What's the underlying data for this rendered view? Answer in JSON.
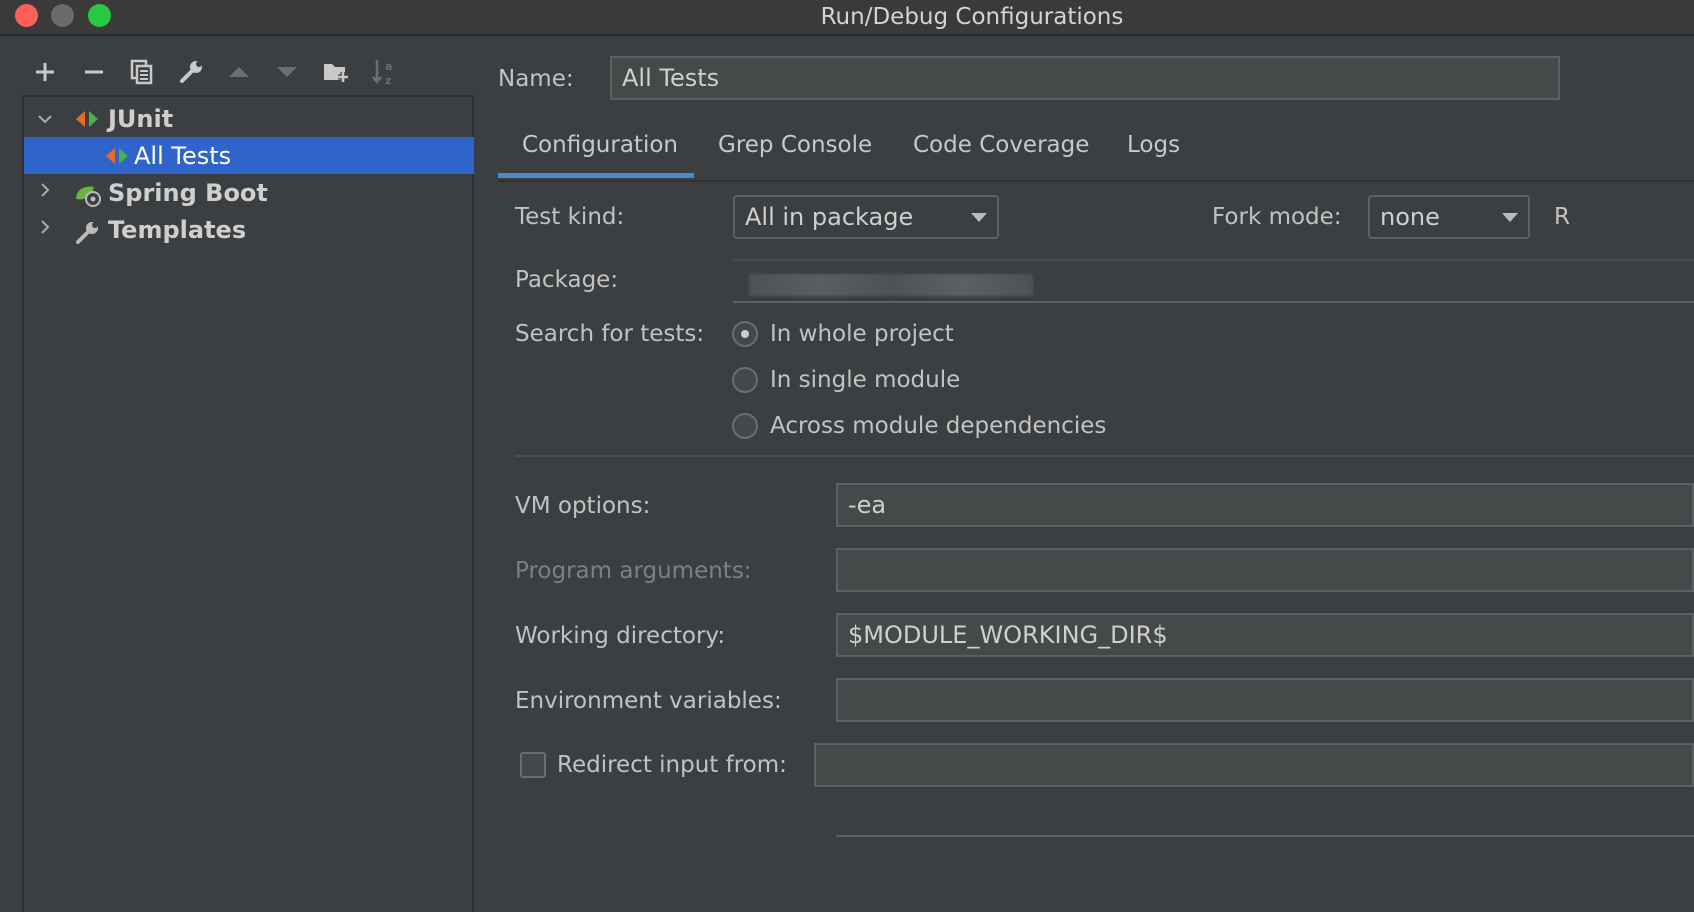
{
  "window": {
    "title": "Run/Debug Configurations"
  },
  "toolbar": {
    "icons": [
      "add-icon",
      "remove-icon",
      "copy-icon",
      "wrench-icon",
      "move-up-icon",
      "move-down-icon",
      "new-folder-icon",
      "sort-icon"
    ]
  },
  "tree": {
    "junit_label": "JUnit",
    "all_tests_label": "All Tests",
    "spring_boot_label": "Spring Boot",
    "templates_label": "Templates"
  },
  "form": {
    "name_label": "Name:",
    "name_value": "All Tests",
    "tabs": [
      "Configuration",
      "Grep Console",
      "Code Coverage",
      "Logs"
    ],
    "test_kind_label": "Test kind:",
    "test_kind_value": "All in package",
    "fork_mode_label": "Fork mode:",
    "fork_mode_value": "none",
    "cut_label": "R",
    "package_label": "Package:",
    "search_label": "Search for tests:",
    "radio_whole": "In whole project",
    "radio_single": "In single module",
    "radio_across": "Across module dependencies",
    "vm_label": "VM options:",
    "vm_value": "-ea",
    "program_args_label": "Program arguments:",
    "working_dir_label": "Working directory:",
    "working_dir_value": "$MODULE_WORKING_DIR$",
    "env_label": "Environment variables:",
    "redirect_label": "Redirect input from:"
  },
  "colors": {
    "selection": "#2f65ca",
    "tab_accent": "#4a88c7",
    "background": "#3c3f41"
  }
}
